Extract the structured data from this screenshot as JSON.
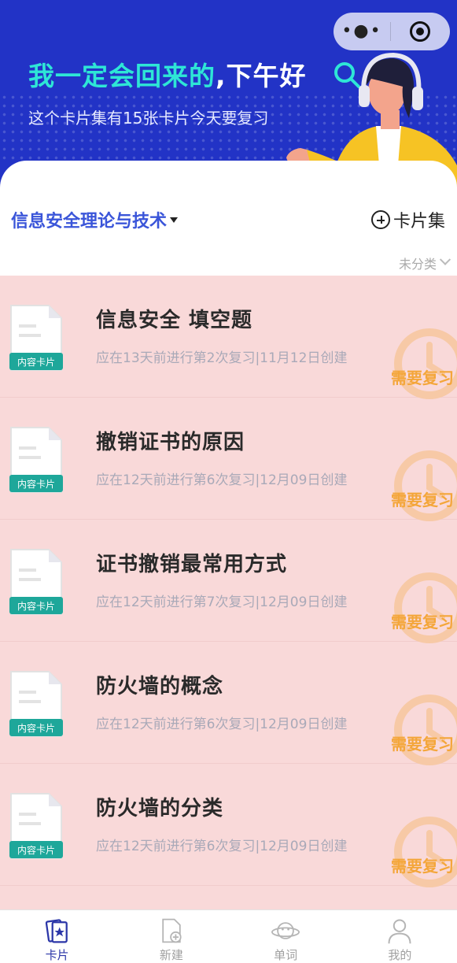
{
  "header": {
    "capsule_more": "•●•",
    "greeting_part1": "我一定会回来的",
    "greeting_part2": ",下午好",
    "subtitle": "这个卡片集有15张卡片今天要复习"
  },
  "set_selector": {
    "name": "信息安全理论与技术",
    "add_label": "卡片集",
    "category": "未分类"
  },
  "cards": [
    {
      "title": "信息安全 填空题",
      "meta": "应在13天前进行第2次复习|11月12日创建",
      "doc_label": "内容卡片",
      "status": "需要复习"
    },
    {
      "title": "撤销证书的原因",
      "meta": "应在12天前进行第6次复习|12月09日创建",
      "doc_label": "内容卡片",
      "status": "需要复习"
    },
    {
      "title": "证书撤销最常用方式",
      "meta": "应在12天前进行第7次复习|12月09日创建",
      "doc_label": "内容卡片",
      "status": "需要复习"
    },
    {
      "title": "防火墙的概念",
      "meta": "应在12天前进行第6次复习|12月09日创建",
      "doc_label": "内容卡片",
      "status": "需要复习"
    },
    {
      "title": "防火墙的分类",
      "meta": "应在12天前进行第6次复习|12月09日创建",
      "doc_label": "内容卡片",
      "status": "需要复习"
    }
  ],
  "tabs": [
    {
      "label": "卡片",
      "icon": "cards-icon",
      "active": true
    },
    {
      "label": "新建",
      "icon": "new-doc-icon",
      "active": false
    },
    {
      "label": "单词",
      "icon": "planet-icon",
      "active": false
    },
    {
      "label": "我的",
      "icon": "user-icon",
      "active": false
    }
  ],
  "colors": {
    "header_bg": "#2233c6",
    "accent_cyan": "#2ee6d6",
    "set_name": "#3a55d9",
    "list_bg": "#f9d9d9",
    "review_orange": "#f4a63a",
    "doc_label_teal": "#1ea79a",
    "tab_active": "#2b36a8"
  }
}
